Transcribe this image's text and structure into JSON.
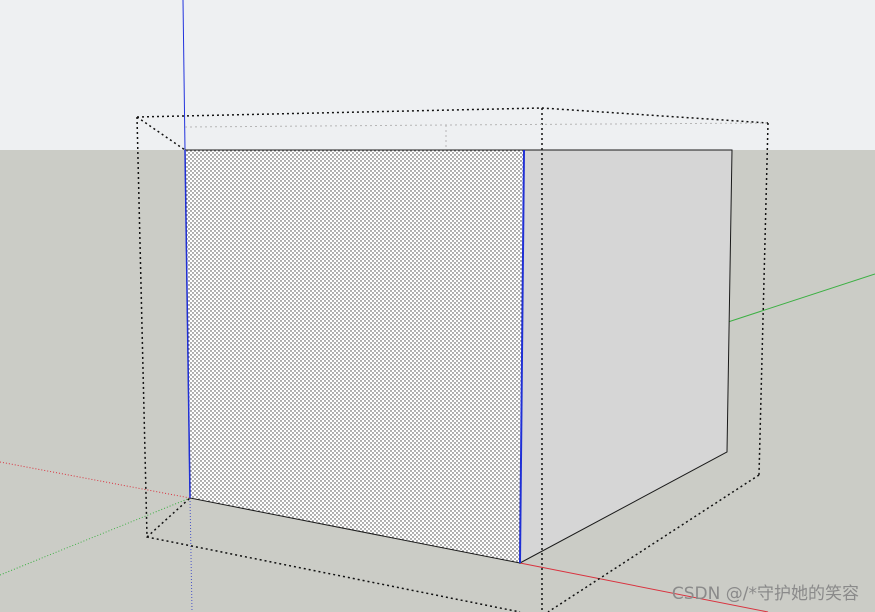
{
  "scene": {
    "sky_color": "#eef0f2",
    "ground_color": "#cbccc6",
    "front_face_color": "#ffffff",
    "side_face_color": "#d6d6d6",
    "selection_color": "#000000",
    "edge_color": "#1a1a1a",
    "axis_colors": {
      "red": "#d9333f",
      "green": "#3cb043",
      "blue": "#1f2fd6"
    }
  },
  "watermark": {
    "text": "CSDN @/*守护她的笑容"
  }
}
